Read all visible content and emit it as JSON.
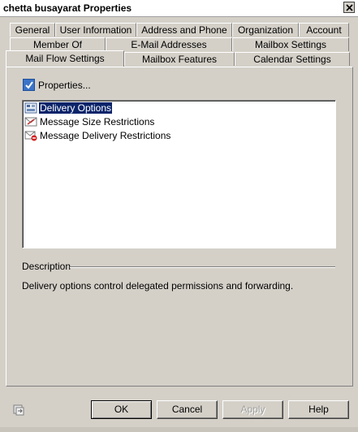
{
  "window": {
    "title": "chetta busayarat Properties"
  },
  "tabs": {
    "row1": [
      "General",
      "User Information",
      "Address and Phone",
      "Organization",
      "Account"
    ],
    "row2": [
      "Member Of",
      "E-Mail Addresses",
      "Mailbox Settings"
    ],
    "row3": [
      "Mail Flow Settings",
      "Mailbox Features",
      "Calendar Settings"
    ],
    "active": "Mail Flow Settings"
  },
  "panel": {
    "properties_label": "Properties...",
    "properties_checked": true,
    "list_items": [
      "Delivery Options",
      "Message Size Restrictions",
      "Message Delivery Restrictions"
    ],
    "selected_item": "Delivery Options",
    "description_label": "Description",
    "description_text": "Delivery options control delegated permissions and forwarding."
  },
  "buttons": {
    "ok": "OK",
    "cancel": "Cancel",
    "apply": "Apply",
    "help": "Help"
  },
  "icons": {
    "close": "close-icon",
    "delivery_options": "delivery-options-icon",
    "size_restrictions": "size-restrictions-icon",
    "delivery_restrictions": "delivery-restrictions-icon",
    "status": "status-bar-icon"
  }
}
